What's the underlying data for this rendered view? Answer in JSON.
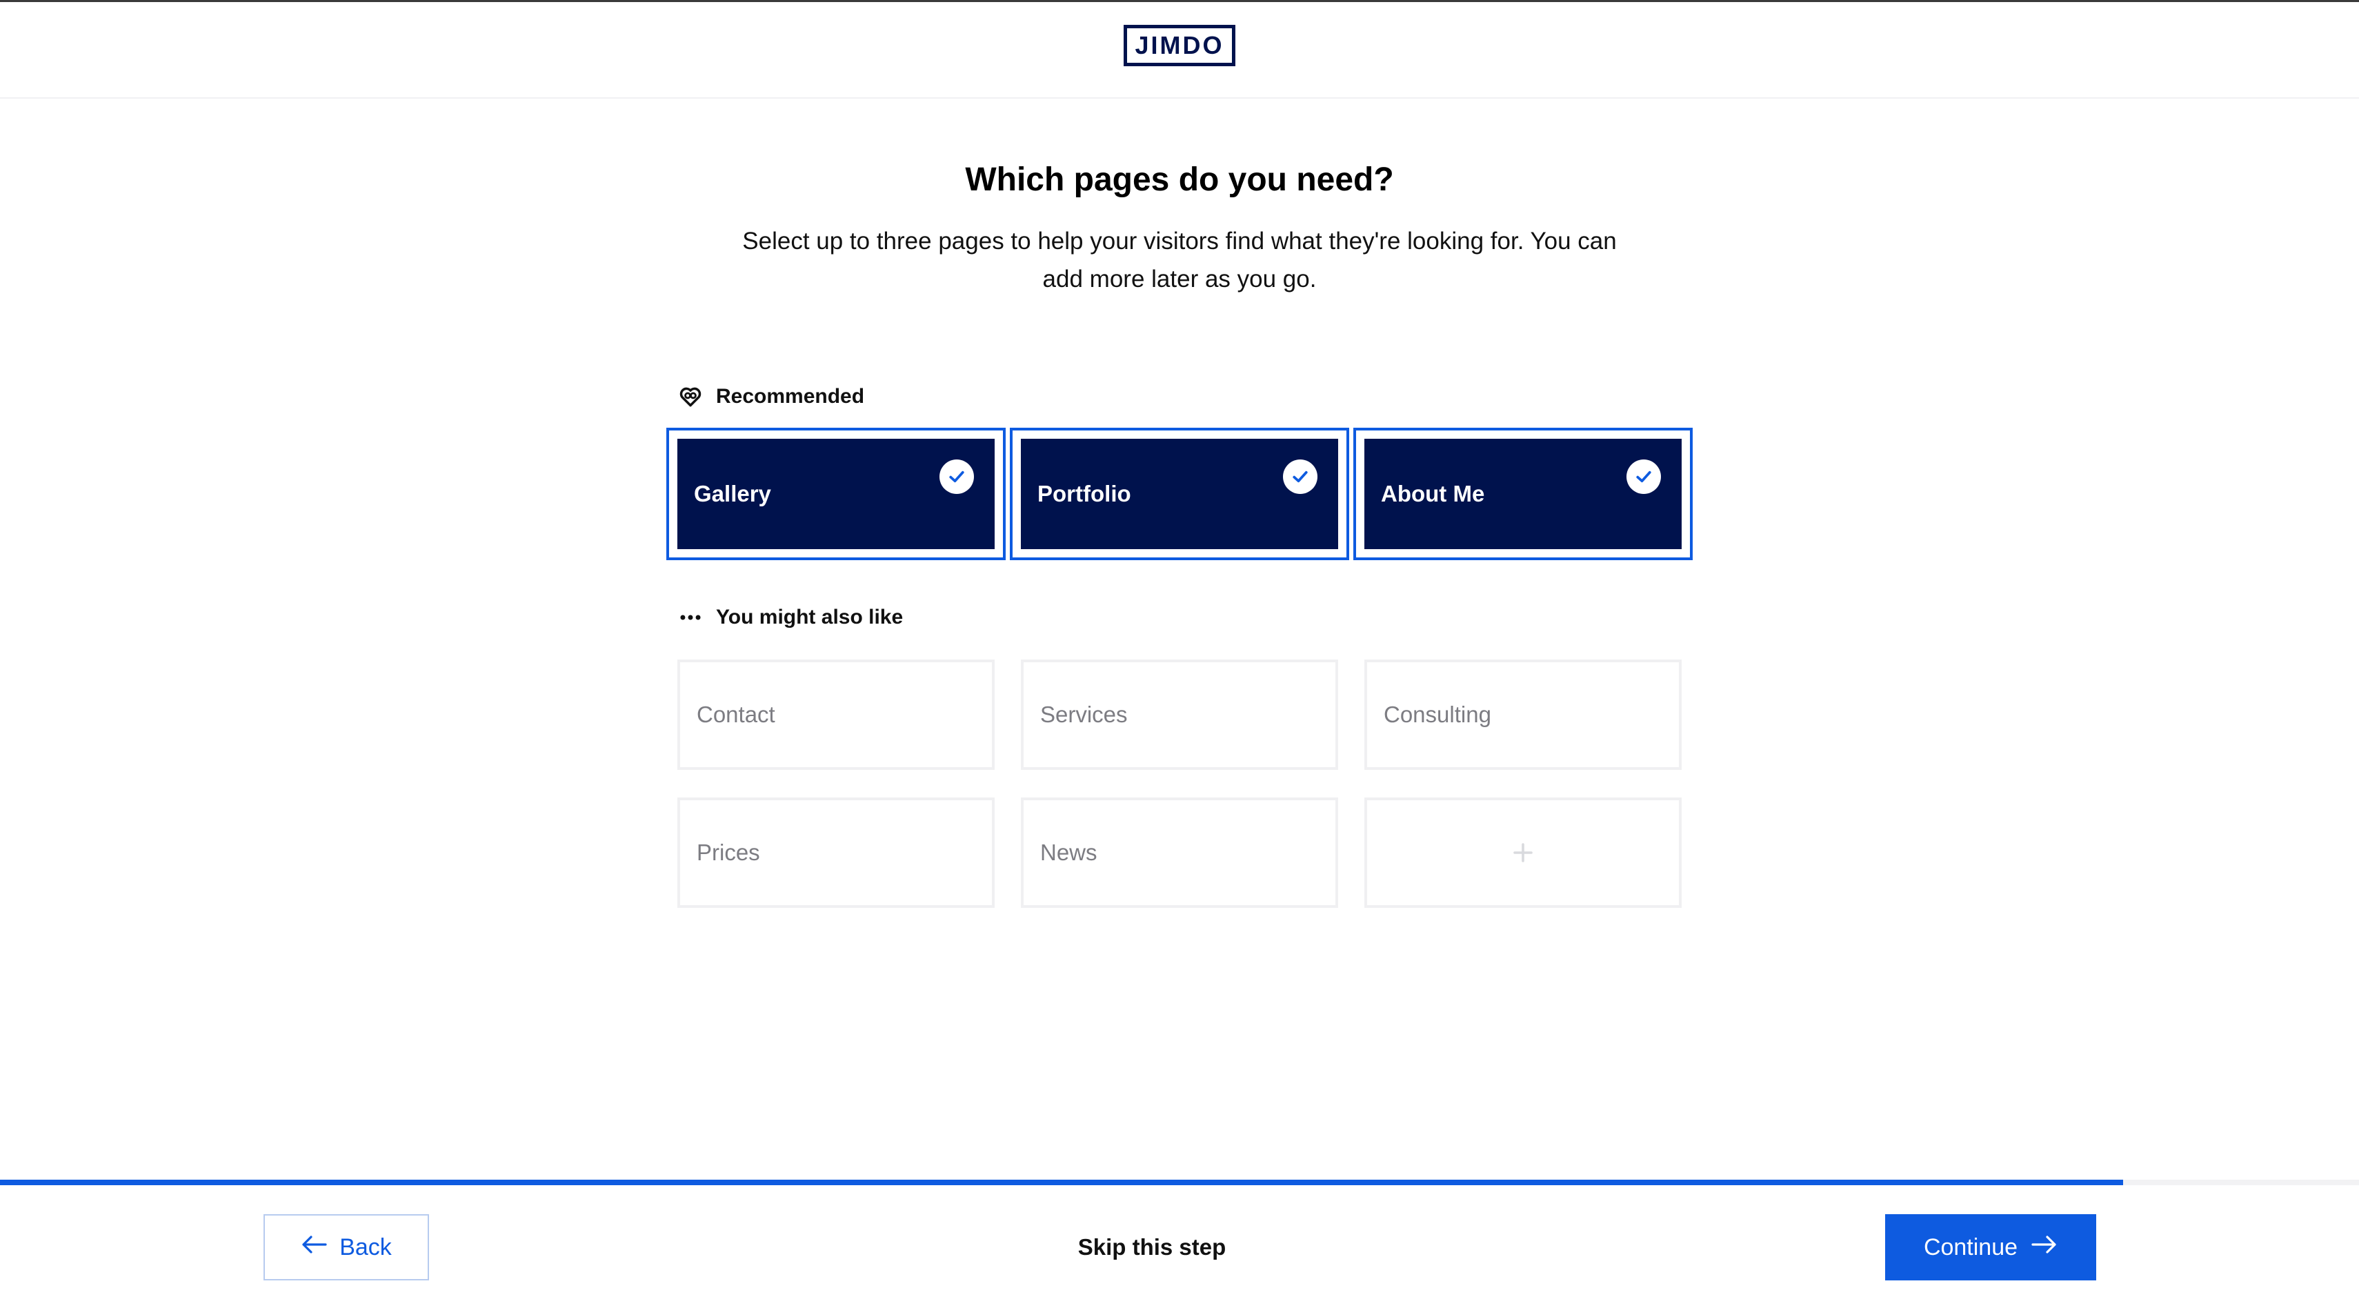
{
  "header": {
    "logo_text": "JIMDO"
  },
  "main": {
    "title": "Which pages do you need?",
    "subtitle_line1": "Select up to three pages to help your visitors find what they're looking for. You can",
    "subtitle_line2": "add more later as you go.",
    "recommended": {
      "label": "Recommended",
      "icon": "heart-icon",
      "cards": [
        {
          "label": "Gallery",
          "selected": true
        },
        {
          "label": "Portfolio",
          "selected": true
        },
        {
          "label": "About Me",
          "selected": true
        }
      ]
    },
    "also_like": {
      "label": "You might also like",
      "icon": "more-dots-icon",
      "cards": [
        {
          "label": "Contact"
        },
        {
          "label": "Services"
        },
        {
          "label": "Consulting"
        },
        {
          "label": "Prices"
        },
        {
          "label": "News"
        }
      ],
      "add_icon": "plus-icon"
    }
  },
  "footer": {
    "progress_fraction": 0.9,
    "back_label": "Back",
    "skip_label": "Skip this step",
    "continue_label": "Continue"
  },
  "colors": {
    "brand_navy": "#00124d",
    "accent_blue": "#0e5be0",
    "muted_text": "#7c7c82",
    "card_border": "#f0f0f2"
  }
}
